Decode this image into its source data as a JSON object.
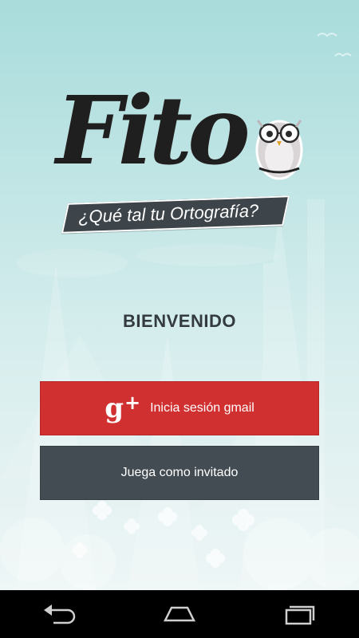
{
  "app": {
    "logo_text": "Fito",
    "tagline": "¿Qué tal tu Ortografía?"
  },
  "welcome": {
    "title": "BIENVENIDO"
  },
  "buttons": {
    "gmail_label": "Inicia sesión gmail",
    "gmail_icon": "google-plus-icon",
    "guest_label": "Juega como invitado"
  },
  "colors": {
    "gmail_button": "#d13030",
    "guest_button": "#434c53",
    "welcome_text": "#333b41",
    "background_top": "#a9dcdc",
    "background_bottom": "#eef6f6"
  },
  "navbar": {
    "back_icon": "back-icon",
    "home_icon": "home-icon",
    "recents_icon": "recent-apps-icon"
  }
}
